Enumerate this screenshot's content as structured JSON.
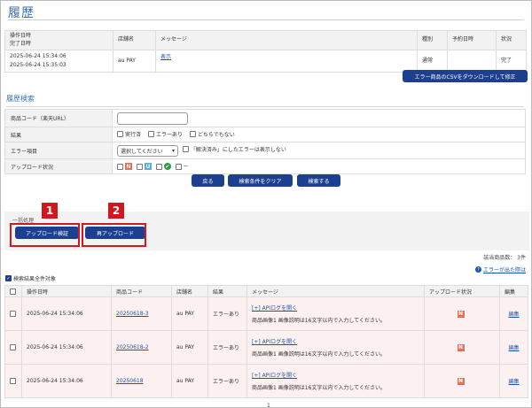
{
  "page": {
    "title": "履歴"
  },
  "history": {
    "headers": {
      "datetime_line1": "操作日時",
      "datetime_line2": "完了日時",
      "shop": "店舗名",
      "message": "メッセージ",
      "type": "種別",
      "scheduled": "予約日時",
      "status": "状況"
    },
    "row": {
      "start": "2025-06-24 15:34:06",
      "end": "2025-06-24 15:35:03",
      "shop": "au PAY",
      "message_link": "表示",
      "type": "通常",
      "scheduled": "",
      "status": "完了"
    },
    "csv_button": "エラー商品のCSVをダウンロードして修正"
  },
  "search": {
    "title": "履歴検索",
    "product_code_label": "商品コード（楽天URL）",
    "product_code_value": "",
    "result_label": "結果",
    "result_options": [
      "実行済",
      "エラーあり",
      "どちらでもない"
    ],
    "error_label": "エラー項目",
    "error_select": "選択してください",
    "error_hide_label": "「解決済み」にしたエラーは表示しない",
    "upload_status_label": "アップロード状況",
    "upload_status_badges": [
      "N",
      "U",
      "✔"
    ],
    "upload_status_none": "—",
    "buttons": {
      "back": "戻る",
      "clear": "検索条件をクリア",
      "search": "検索する"
    }
  },
  "bulk": {
    "label": "一括処理",
    "verify_button": "アップロード検証",
    "reupload_button": "再アップロード",
    "marker1": "1",
    "marker2": "2"
  },
  "summary": {
    "count": "該当商品数： 3件",
    "help_link": "エラーが出た際は",
    "select_all_label": "検索結果全件対象"
  },
  "results": {
    "headers": {
      "datetime": "操作日時",
      "code": "商品コード",
      "shop": "店舗名",
      "result": "結果",
      "message": "メッセージ",
      "upload_status": "アップロード状況",
      "edit": "編集"
    },
    "rows": [
      {
        "datetime": "2025-06-24 15:34:06",
        "code": "20250618-3",
        "shop": "au PAY",
        "result": "エラーあり",
        "message_link": "[+] APIログを開く",
        "message": "商品画像1 画像説明は16文字以内で入力してください。",
        "badge": "N",
        "edit": "編集"
      },
      {
        "datetime": "2025-06-24 15:34:06",
        "code": "20250618-2",
        "shop": "au PAY",
        "result": "エラーあり",
        "message_link": "[+] APIログを開く",
        "message": "商品画像1 画像説明は16文字以内で入力してください。",
        "badge": "N",
        "edit": "編集"
      },
      {
        "datetime": "2025-06-24 15:34:06",
        "code": "20250618",
        "shop": "au PAY",
        "result": "エラーあり",
        "message_link": "[+] APIログを開く",
        "message": "商品画像1 画像説明は16文字以内で入力してください。",
        "badge": "N",
        "edit": "編集"
      }
    ]
  },
  "pagination": {
    "current": "1"
  },
  "colors": {
    "accent": "#1d3f8f",
    "title": "#3a6fb5",
    "highlight": "#d0191f",
    "error_row": "#fdf0f0"
  },
  "icons": {
    "help": "help-circle-icon",
    "checkbox": "checkbox-icon",
    "chevron": "chevron-down-icon"
  }
}
